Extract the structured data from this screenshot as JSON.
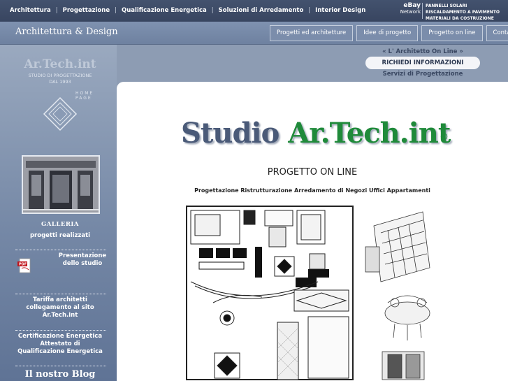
{
  "topnav": {
    "items": [
      "Architettura",
      "Progettazione",
      "Qualificazione Energetica",
      "Soluzioni di Arredamento",
      "Interior Design"
    ],
    "separator": "|"
  },
  "ebay": {
    "brand": "eBay",
    "network": "Network",
    "links": [
      "PANNELLI SOLARI",
      "RISCALDAMENTO A PAVIMENTO",
      "MATERIALI DA COSTRUZIONE"
    ]
  },
  "header": {
    "brand": "Architettura & Design",
    "tabs": [
      "Progetti ed architetture",
      "Idee di progetto",
      "Progetto on line",
      "Contatti"
    ]
  },
  "sidebar": {
    "logo_title": "Ar.Tech.int",
    "logo_sub_1": "STUDIO DI PROGETTAZIONE",
    "logo_sub_2": "DAL 1993",
    "home_1": "HOME",
    "home_2": "PAGE",
    "gallery_title": "GALLERIA",
    "gallery_sub": "progetti realizzati",
    "presentazione_1": "Presentazione",
    "presentazione_2": "dello studio",
    "tariffa_1": "Tariffa architetti",
    "tariffa_2": "collegamento al sito",
    "tariffa_3": "Ar.Tech.int",
    "cert_1": "Certificazione Energetica",
    "cert_2": "Attestato di",
    "cert_3": "Qualificazione Energetica",
    "blog": "Il nostro Blog"
  },
  "right_links": {
    "architetto_online": "« L' Architetto On Line »",
    "richiedi": "RICHIEDI INFORMAZIONI",
    "servizi": "Servizi di Progettazione"
  },
  "main": {
    "title_part1": "Studio",
    "title_part2": "Ar.Tech.int",
    "copyright": "©",
    "heading": "PROGETTO ON LINE",
    "subheading": "Progettazione Ristrutturazione Arredamento di Negozi Uffici Appartamenti"
  },
  "colors": {
    "topbar": "#3d4b66",
    "sidebar": "#7588a6",
    "title_gray": "#4a5a78",
    "title_green": "#1f8a3a",
    "pdf_red": "#c0141b"
  },
  "icons": [
    "home-diamond-icon",
    "pdf-icon"
  ]
}
